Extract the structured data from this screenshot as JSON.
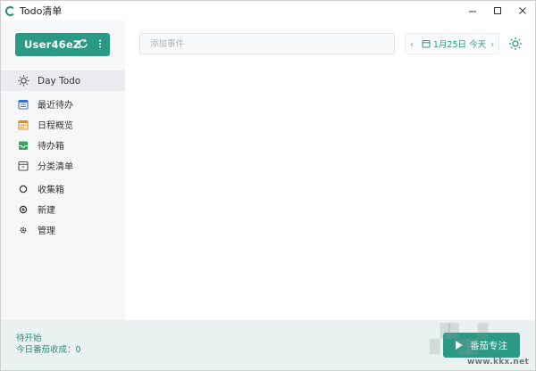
{
  "app": {
    "title": "Todo清单"
  },
  "user": {
    "name": "User46eZ"
  },
  "sidebar": {
    "items": [
      {
        "label": "Day Todo",
        "icon": "sun-icon",
        "active": true
      },
      {
        "label": "最近待办",
        "icon": "calendar-list-icon"
      },
      {
        "label": "日程概览",
        "icon": "calendar-grid-icon"
      },
      {
        "label": "待办箱",
        "icon": "inbox-icon"
      },
      {
        "label": "分类清单",
        "icon": "category-box-icon"
      },
      {
        "label": "收集箱",
        "icon": "circle-icon"
      },
      {
        "label": "新建",
        "icon": "plus-circle-icon"
      },
      {
        "label": "管理",
        "icon": "gear-icon"
      }
    ]
  },
  "main": {
    "input_placeholder": "添加事件",
    "date_label": "1月25日 今天"
  },
  "footer": {
    "status": "待开始",
    "summary": "今日番茄收成：0",
    "start_button": "番茄专注"
  },
  "watermark": {
    "url": "www.kkx.net"
  },
  "colors": {
    "accent": "#2b9a85",
    "sidebar_bg": "#f6f7f9",
    "footer_bg": "#eaf1f1"
  }
}
